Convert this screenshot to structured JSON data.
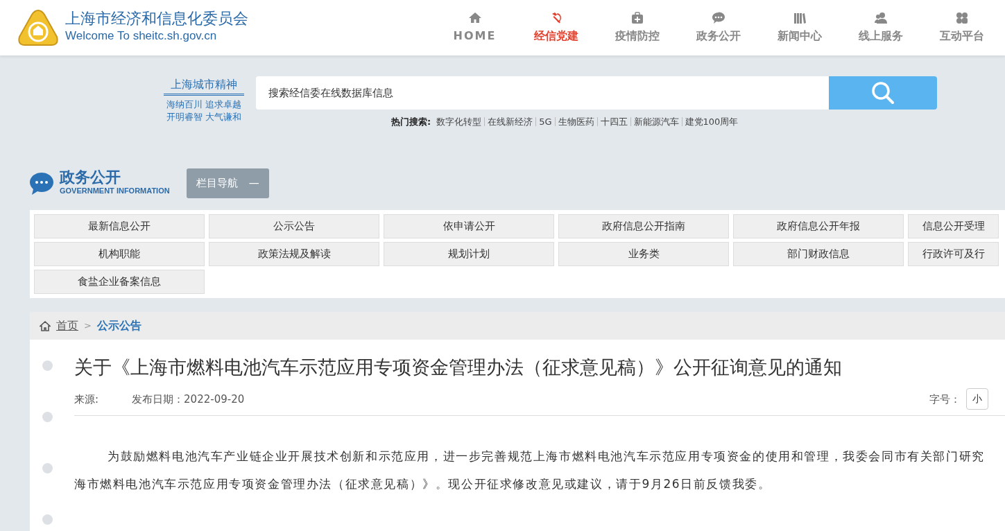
{
  "header": {
    "title": "上海市经济和信息化委员会",
    "subtitle": "Welcome To sheitc.sh.gov.cn"
  },
  "nav": [
    {
      "label": "HOME",
      "kind": "home",
      "selected": false
    },
    {
      "label": "经信党建",
      "kind": "party",
      "selected": true
    },
    {
      "label": "疫情防控",
      "kind": "medkit",
      "selected": false
    },
    {
      "label": "政务公开",
      "kind": "chat",
      "selected": false
    },
    {
      "label": "新闻中心",
      "kind": "books",
      "selected": false
    },
    {
      "label": "线上服务",
      "kind": "users",
      "selected": false
    },
    {
      "label": "互动平台",
      "kind": "grid",
      "selected": false
    }
  ],
  "slogan": {
    "title": "上海城市精神",
    "lines": [
      "海纳百川 追求卓越",
      "开明睿智 大气谦和"
    ]
  },
  "search": {
    "placeholder": "搜索经信委在线数据库信息"
  },
  "hot_search": {
    "label": "热门搜索:",
    "items": [
      "数字化转型",
      "在线新经济",
      "5G",
      "生物医药",
      "十四五",
      "新能源汽车",
      "建党100周年"
    ]
  },
  "section": {
    "title": "政务公开",
    "subtitle": "GOVERNMENT INFORMATION",
    "toggle_label": "栏目导航",
    "toggle_symbol": "—"
  },
  "categories": [
    "最新信息公开",
    "公示公告",
    "依申请公开",
    "政府信息公开指南",
    "政府信息公开年报",
    "信息公开受理",
    "机构职能",
    "政策法规及解读",
    "规划计划",
    "业务类",
    "部门财政信息",
    "行政许可及行",
    "食盐企业备案信息"
  ],
  "breadcrumb": [
    {
      "label": "首页",
      "current": false
    },
    {
      "label": "公示公告",
      "current": true
    }
  ],
  "breadcrumb_separator": ">",
  "article": {
    "title": "关于《上海市燃料电池汽车示范应用专项资金管理办法（征求意见稿）》公开征询意见的通知",
    "source_label": "来源:",
    "date_label": "发布日期：2022-09-20",
    "font_size_label": "字号：",
    "font_size_button": "小",
    "paragraph_lines": [
      "为鼓励燃料电池汽车产业链企业开展技术创新和示范应用，进一步完善规范上海市燃料电池汽车示范应用专项资金的使用和管理，我委会同市有关部门研究",
      "海市燃料电池汽车示范应用专项资金管理办法（征求意见稿）》。现公开征求修改意见或建议，请于9月26日前反馈我委。"
    ]
  }
}
